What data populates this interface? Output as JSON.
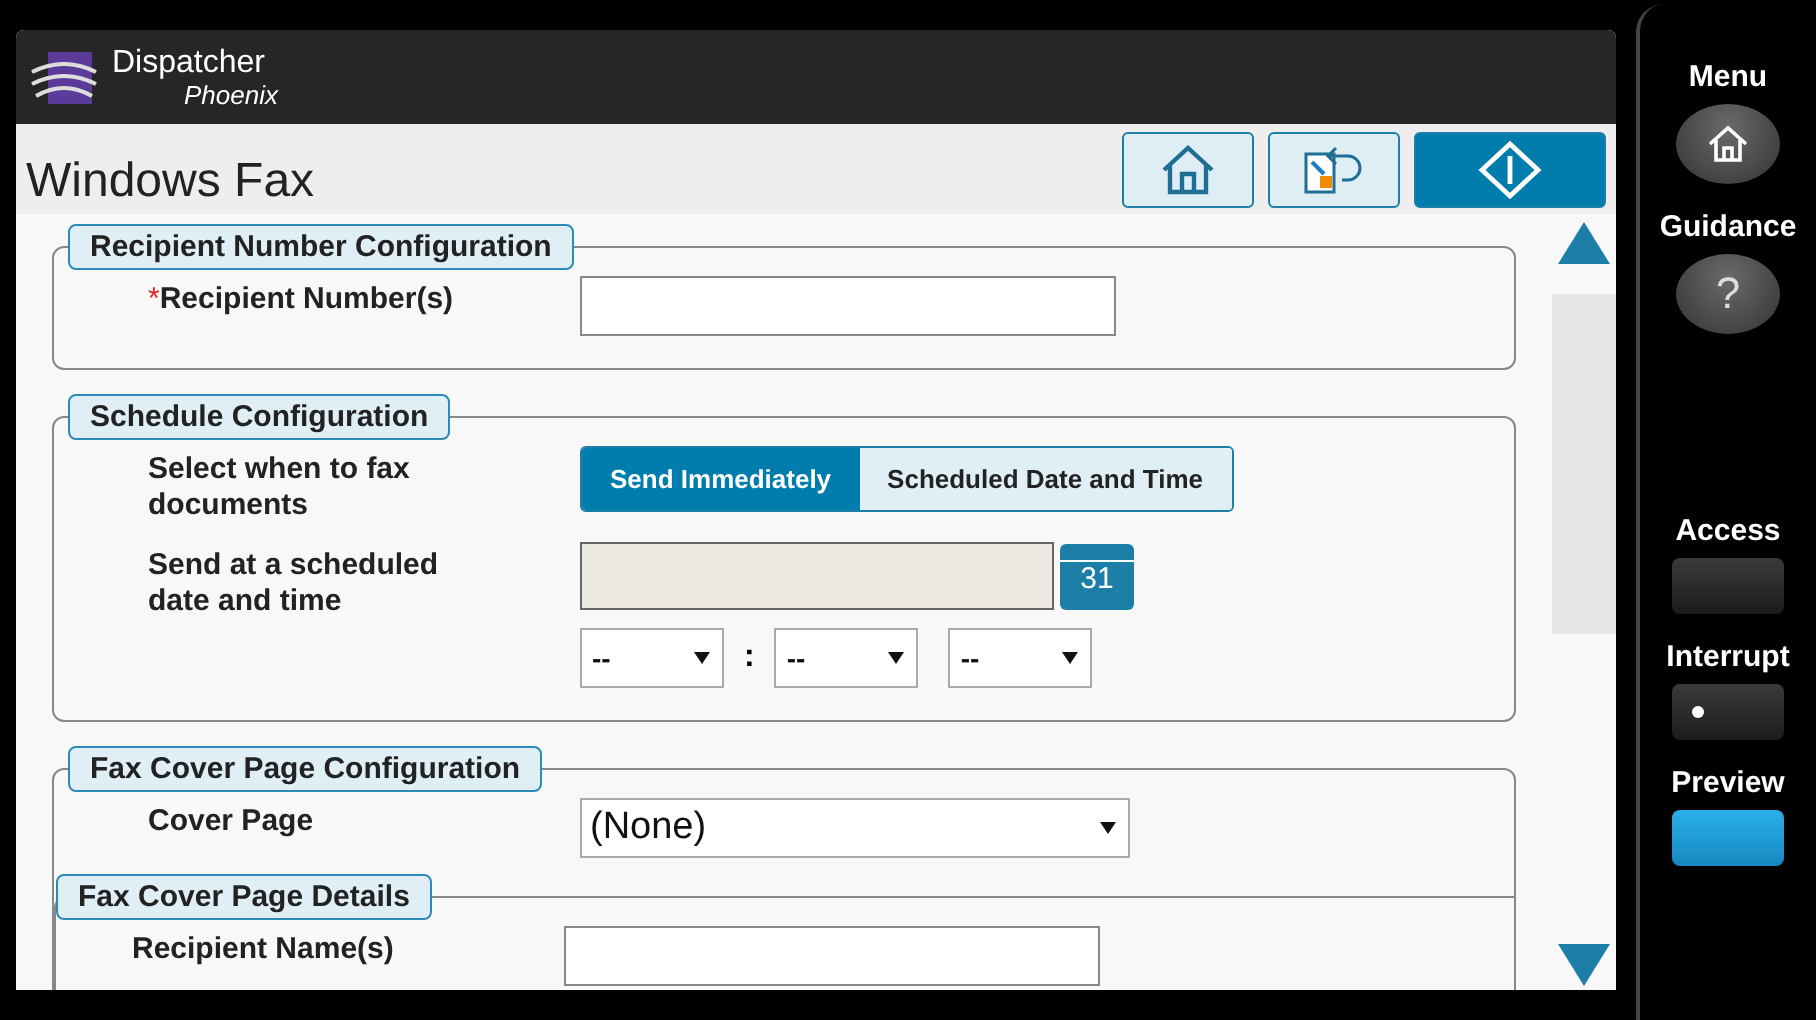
{
  "header": {
    "brand": "Dispatcher",
    "sub_brand": "Phoenix"
  },
  "page_title": "Windows Fax",
  "toolbar": [
    {
      "kind": "home"
    },
    {
      "kind": "back"
    },
    {
      "kind": "start"
    }
  ],
  "sections": [
    {
      "legend": "Recipient Number Configuration",
      "rows": [
        {
          "kind": "text",
          "label": "Recipient Number(s)",
          "required": true,
          "required_mark": "*"
        }
      ]
    },
    {
      "legend": "Schedule Configuration",
      "rows": [
        {
          "kind": "toggle",
          "label": "Select when to fax documents",
          "options": [
            {
              "label": "Send Immediately",
              "selected": true
            },
            {
              "label": "Scheduled Date and Time",
              "selected": false
            }
          ]
        },
        {
          "kind": "datetime",
          "label": "Send at a scheduled date and time",
          "disabled": true,
          "calendar_day": "31",
          "selects": [
            "--",
            "--",
            "--"
          ],
          "separator": ":"
        }
      ]
    },
    {
      "legend": "Fax Cover Page Configuration",
      "rows": [
        {
          "kind": "select",
          "label": "Cover Page",
          "value": "(None)"
        }
      ],
      "subsections": [
        {
          "legend": "Fax Cover Page Details",
          "rows": [
            {
              "kind": "text",
              "label": "Recipient Name(s)"
            }
          ]
        }
      ]
    }
  ],
  "side_panel": [
    {
      "label": "Menu",
      "kind": "home"
    },
    {
      "label": "Guidance",
      "kind": "help",
      "glyph": "?"
    },
    {
      "label": "Access",
      "kind": "plain"
    },
    {
      "label": "Interrupt",
      "kind": "dot"
    },
    {
      "label": "Preview",
      "kind": "lit"
    }
  ]
}
